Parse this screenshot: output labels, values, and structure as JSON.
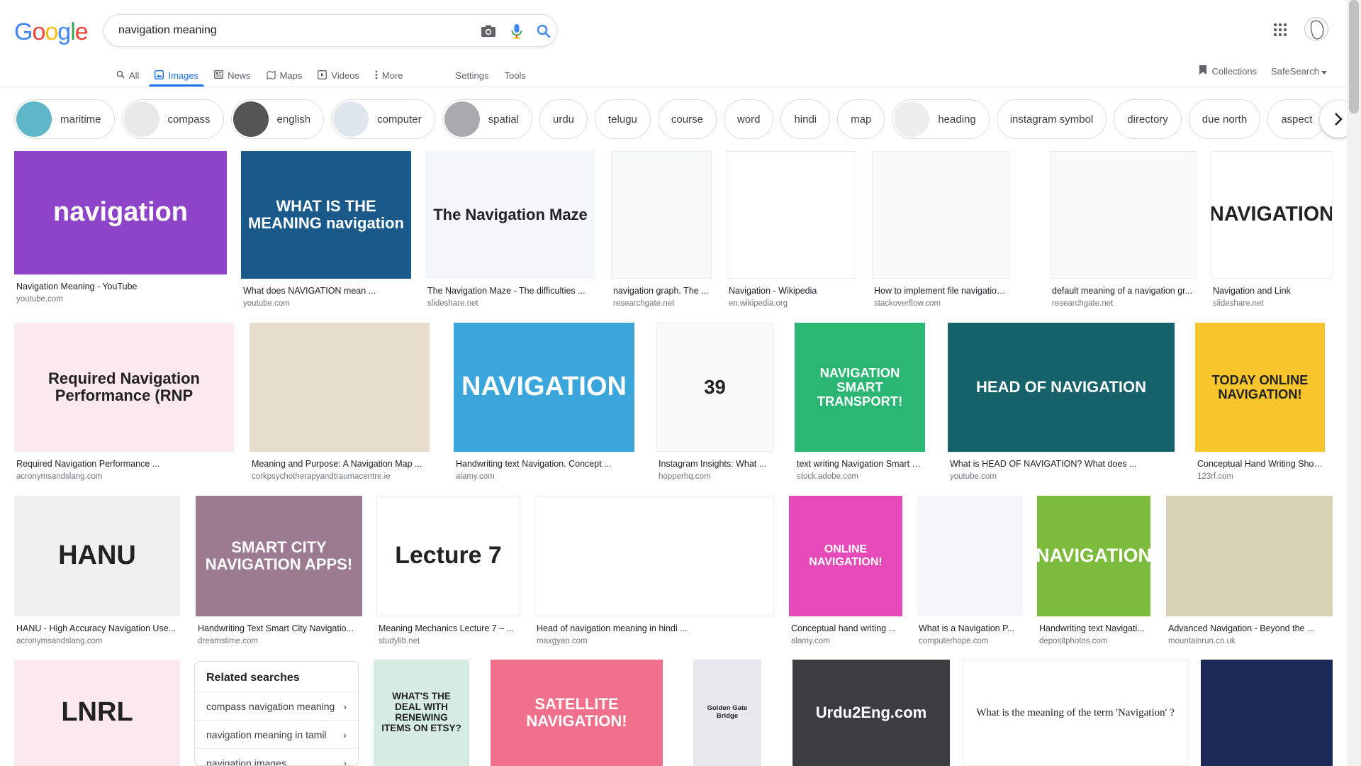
{
  "header": {
    "logo": "Google",
    "search_value": "navigation meaning",
    "camera_icon": "camera-icon",
    "mic_icon": "mic-icon",
    "search_icon": "search-icon"
  },
  "tabs": [
    {
      "label": "All",
      "icon": "search-icon"
    },
    {
      "label": "Images",
      "icon": "image-icon",
      "active": true
    },
    {
      "label": "News",
      "icon": "news-icon"
    },
    {
      "label": "Maps",
      "icon": "map-icon"
    },
    {
      "label": "Videos",
      "icon": "video-icon"
    },
    {
      "label": "More",
      "icon": "more-icon"
    },
    {
      "label": "Settings"
    },
    {
      "label": "Tools"
    }
  ],
  "right_tools": {
    "collections": "Collections",
    "safesearch": "SafeSearch"
  },
  "chips": [
    {
      "label": "maritime",
      "thumb": "#5fb6c9"
    },
    {
      "label": "compass",
      "thumb": "#e8e8e8"
    },
    {
      "label": "english",
      "thumb": "#555555"
    },
    {
      "label": "computer",
      "thumb": "#dfe6ee"
    },
    {
      "label": "spatial",
      "thumb": "#a9a9b0"
    },
    {
      "label": "urdu"
    },
    {
      "label": "telugu"
    },
    {
      "label": "course"
    },
    {
      "label": "word"
    },
    {
      "label": "hindi"
    },
    {
      "label": "map"
    },
    {
      "label": "heading",
      "thumb": "#eeeeee"
    },
    {
      "label": "instagram symbol"
    },
    {
      "label": "directory"
    },
    {
      "label": "due north"
    },
    {
      "label": "aspect"
    }
  ],
  "results": [
    {
      "title": "Navigation Meaning - YouTube",
      "source": "youtube.com",
      "overlay": "navigation",
      "color": "#8e44c9"
    },
    {
      "title": "What does NAVIGATION mean ...",
      "source": "youtube.com",
      "overlay": "WHAT IS THE MEANING navigation",
      "color": "#1a5a8a"
    },
    {
      "title": "The Navigation Maze - The difficulties ...",
      "source": "slideshare.net",
      "overlay": "The Navigation Maze",
      "color": "#f4f7fa"
    },
    {
      "title": "navigation graph. The ...",
      "source": "researchgate.net",
      "overlay": "",
      "color": "#f6faf6"
    },
    {
      "title": "Navigation - Wikipedia",
      "source": "en.wikipedia.org",
      "overlay": "",
      "color": "#ffffff"
    },
    {
      "title": "How to implement file navigation ...",
      "source": "stackoverflow.com",
      "overlay": "",
      "color": "#fbfbfb"
    },
    {
      "title": "default meaning of a navigation gr...",
      "source": "researchgate.net",
      "overlay": "",
      "color": "#fafafa"
    },
    {
      "title": "Navigation and Link",
      "source": "slideshare.net",
      "overlay": "NAVIGATION",
      "color": "#ffffff"
    },
    {
      "title": "Required Navigation Performance ...",
      "source": "acronymsandslang.com",
      "overlay": "Required Navigation Performance (RNP",
      "color": "#fbe9ef"
    },
    {
      "title": "Meaning and Purpose: A Navigation Map ...",
      "source": "corkpsychotherapyandtraumacentre.ie",
      "overlay": "",
      "color": "#e6dccb"
    },
    {
      "title": "Handwriting text Navigation. Concept ...",
      "source": "alamy.com",
      "overlay": "NAVIGATION",
      "color": "#3aa6dc"
    },
    {
      "title": "Instagram Insights: What ...",
      "source": "hopperhq.com",
      "overlay": "39",
      "color": "#fafafa"
    },
    {
      "title": "text writing Navigation Smart Tra...",
      "source": "stock.adobe.com",
      "overlay": "NAVIGATION SMART TRANSPORT!",
      "color": "#2bb673"
    },
    {
      "title": "What is HEAD OF NAVIGATION? What does ...",
      "source": "youtube.com",
      "overlay": "HEAD OF NAVIGATION",
      "color": "#15626a"
    },
    {
      "title": "Conceptual Hand Writing Showin...",
      "source": "123rf.com",
      "overlay": "TODAY ONLINE NAVIGATION!",
      "color": "#f7c52c"
    },
    {
      "title": "HANU - High Accuracy Navigation Use...",
      "source": "acronymsandslang.com",
      "overlay": "HANU",
      "color": "#f0f0f0"
    },
    {
      "title": "Handwriting Text Smart City Navigatio...",
      "source": "dreamstime.com",
      "overlay": "SMART CITY NAVIGATION APPS!",
      "color": "#9c7a8f"
    },
    {
      "title": "Meaning Mechanics Lecture 7 – ...",
      "source": "studylib.net",
      "overlay": "Lecture 7",
      "color": "#ffffff"
    },
    {
      "title": "Head of navigation meaning in hindi ...",
      "source": "maxgyan.com",
      "overlay": "",
      "color": "#ffffff"
    },
    {
      "title": "Conceptual hand writing ...",
      "source": "alamy.com",
      "overlay": "ONLINE NAVIGATION!",
      "color": "#e54ab8"
    },
    {
      "title": "What is a Navigation P...",
      "source": "computerhope.com",
      "overlay": "",
      "color": "#f4f6f9"
    },
    {
      "title": "Handwriting text Navigati...",
      "source": "depositphotos.com",
      "overlay": "NAVIGATION",
      "color": "#7dbb3c"
    },
    {
      "title": "Advanced Navigation - Beyond the ...",
      "source": "mountainrun.co.uk",
      "overlay": "",
      "color": "#d9d2b6"
    },
    {
      "title": "",
      "source": "",
      "overlay": "LNRL",
      "color": "#fbe9ef"
    },
    {
      "title": "",
      "source": "",
      "overlay": "WHAT'S THE DEAL WITH RENEWING ITEMS ON ETSY?",
      "color": "#d5ece0"
    },
    {
      "title": "",
      "source": "",
      "overlay": "SATELLITE NAVIGATION!",
      "color": "#f06f8a"
    },
    {
      "title": "",
      "source": "",
      "overlay": "Golden Gate Bridge",
      "color": "#e7e9ee"
    },
    {
      "title": "",
      "source": "",
      "overlay": "Urdu2Eng.com",
      "color": "#3b3d40"
    },
    {
      "title": "",
      "source": "",
      "overlay": "What is the meaning of the term 'Navigation' ?",
      "color": "#ffffff"
    },
    {
      "title": "",
      "source": "",
      "overlay": "",
      "color": "#1b2a58"
    }
  ],
  "related": {
    "heading": "Related searches",
    "items": [
      "compass navigation meaning",
      "navigation meaning in tamil",
      "navigation images"
    ]
  },
  "colors": {
    "accent": "#1a73e8",
    "text": "#202124",
    "muted": "#70757a"
  }
}
